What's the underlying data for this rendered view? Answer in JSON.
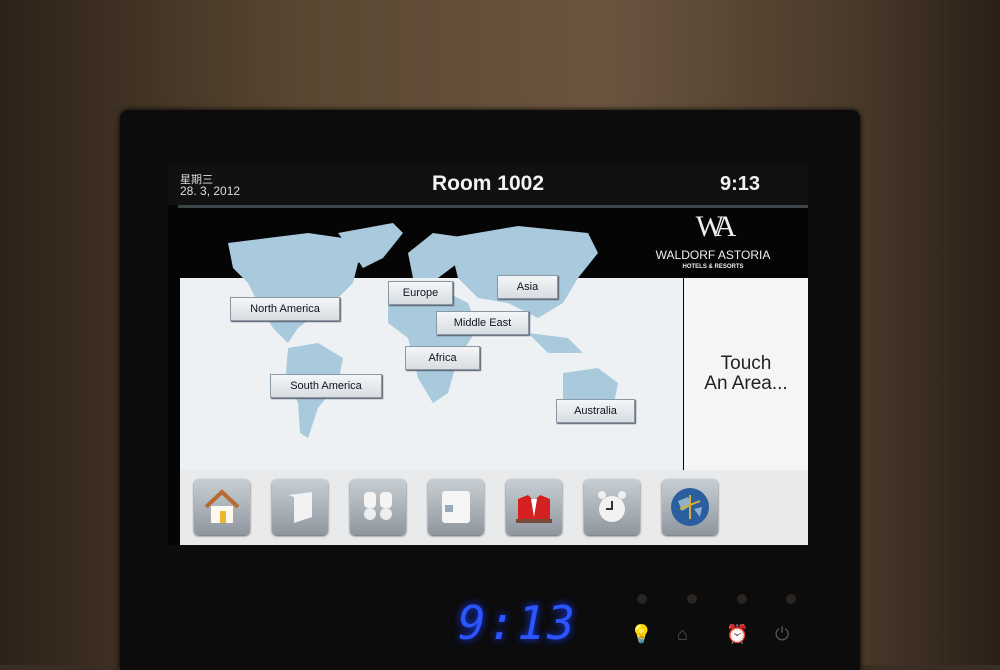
{
  "header": {
    "weekday": "星期三",
    "date": "28. 3, 2012",
    "room": "Room 1002",
    "time": "9:13"
  },
  "brand": {
    "monogram": "WA",
    "name": "WALDORF ASTORIA",
    "tagline": "HOTELS & RESORTS"
  },
  "regions": [
    "North America",
    "Europe",
    "Asia",
    "Middle East",
    "Africa",
    "South America",
    "Australia"
  ],
  "prompt": {
    "line1": "Touch",
    "line2": "An Area..."
  },
  "toolbar": [
    "home-icon",
    "curtain-icon",
    "lights-icon",
    "thermostat-icon",
    "butler-service-icon",
    "alarm-clock-icon",
    "globe-icon"
  ],
  "front_panel": {
    "clock": "9:13",
    "buttons": [
      "light-bulb-icon",
      "home-icon",
      "alarm-clock-icon",
      "power-icon"
    ]
  },
  "colors": {
    "map": "#a9c9dd",
    "clock": "#2a55ff",
    "service_red": "#d42020"
  }
}
